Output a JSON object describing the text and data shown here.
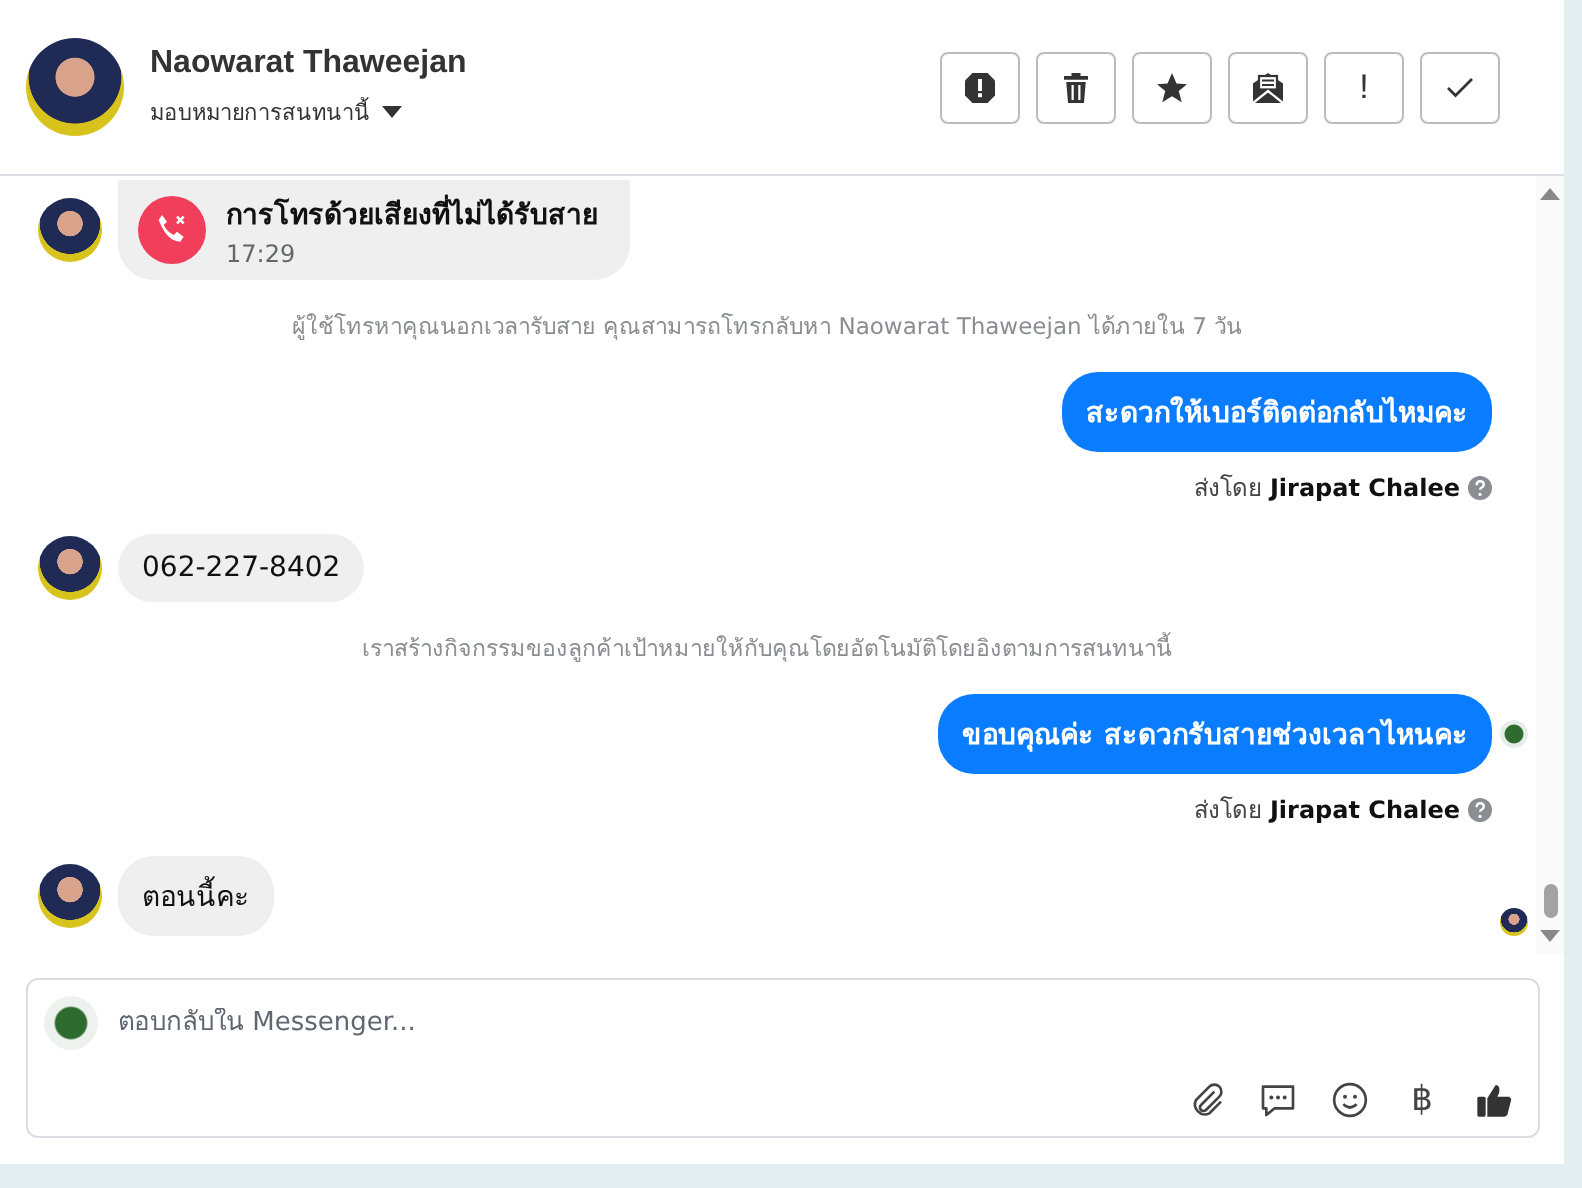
{
  "header": {
    "name": "Naowarat Thaweejan",
    "assign_label": "มอบหมายการสนทนานี้",
    "actions": [
      {
        "kind": "alert"
      },
      {
        "kind": "trash"
      },
      {
        "kind": "star"
      },
      {
        "kind": "mail"
      },
      {
        "kind": "text",
        "label": "!"
      },
      {
        "kind": "check"
      }
    ]
  },
  "messages": [
    {
      "kind": "call",
      "text": "การโทรด้วยเสียงที่ไม่ได้รับสาย",
      "time": "17:29"
    },
    {
      "kind": "notice",
      "text": "ผู้ใช้โทรหาคุณนอกเวลารับสาย คุณสามารถโทรกลับหา Naowarat Thaweejan ได้ภายใน 7 วัน"
    },
    {
      "kind": "outgoing",
      "text": "สะดวกให้เบอร์ติดต่อกลับไหมคะ",
      "sent_prefix": "ส่งโดย",
      "sender": "Jirapat Chalee"
    },
    {
      "kind": "incoming",
      "text": "062-227-8402"
    },
    {
      "kind": "notice",
      "text": "เราสร้างกิจกรรมของลูกค้าเป้าหมายให้กับคุณโดยอัตโนมัติโดยอิงตามการสนทนานี้"
    },
    {
      "kind": "outgoing",
      "text": "ขอบคุณค่ะ สะดวกรับสายช่วงเวลาไหนคะ",
      "sent_prefix": "ส่งโดย",
      "sender": "Jirapat Chalee",
      "read_receipt": {
        "kind": "logo"
      }
    },
    {
      "kind": "incoming",
      "text": "ตอนนี้คะ",
      "read_receipt": {
        "kind": "avatar"
      }
    }
  ],
  "composer": {
    "placeholder": "ตอบกลับใน Messenger...",
    "tools": [
      {
        "kind": "attach"
      },
      {
        "kind": "chat"
      },
      {
        "kind": "emoji"
      },
      {
        "kind": "text",
        "label": "฿"
      },
      {
        "kind": "like"
      }
    ]
  }
}
